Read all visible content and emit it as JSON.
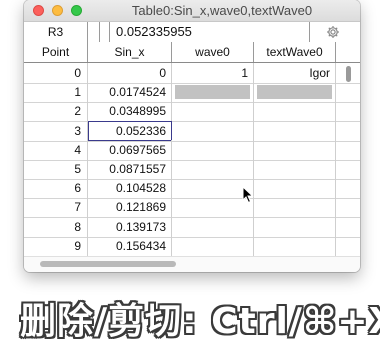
{
  "window": {
    "title": "Table0:Sin_x,wave0,textWave0"
  },
  "entry_line": {
    "target_cell": "R3",
    "value": "0.052335955",
    "icon": "gear-icon"
  },
  "table": {
    "headers": [
      "Point",
      "Sin_x",
      "wave0",
      "textWave0"
    ],
    "rows": [
      {
        "point": "0",
        "sin_x": "0",
        "wave0": "1",
        "text": "Igor"
      },
      {
        "point": "1",
        "sin_x": "0.0174524",
        "wave0": "",
        "text": ""
      },
      {
        "point": "2",
        "sin_x": "0.0348995",
        "wave0": "",
        "text": ""
      },
      {
        "point": "3",
        "sin_x": "0.052336",
        "wave0": "",
        "text": ""
      },
      {
        "point": "4",
        "sin_x": "0.0697565",
        "wave0": "",
        "text": ""
      },
      {
        "point": "5",
        "sin_x": "0.0871557",
        "wave0": "",
        "text": ""
      },
      {
        "point": "6",
        "sin_x": "0.104528",
        "wave0": "",
        "text": ""
      },
      {
        "point": "7",
        "sin_x": "0.121869",
        "wave0": "",
        "text": ""
      },
      {
        "point": "8",
        "sin_x": "0.139173",
        "wave0": "",
        "text": ""
      },
      {
        "point": "9",
        "sin_x": "0.156434",
        "wave0": "",
        "text": ""
      }
    ],
    "selected_row_index": 3
  },
  "caption": {
    "text": "删除/剪切: Ctrl/⌘+X"
  },
  "colors": {
    "close": "#fc605c",
    "minimize": "#fdbc40",
    "maximize": "#34c84a",
    "selection_outline": "#3a3a8c",
    "unset_cell_fill": "#c2c2c2"
  }
}
